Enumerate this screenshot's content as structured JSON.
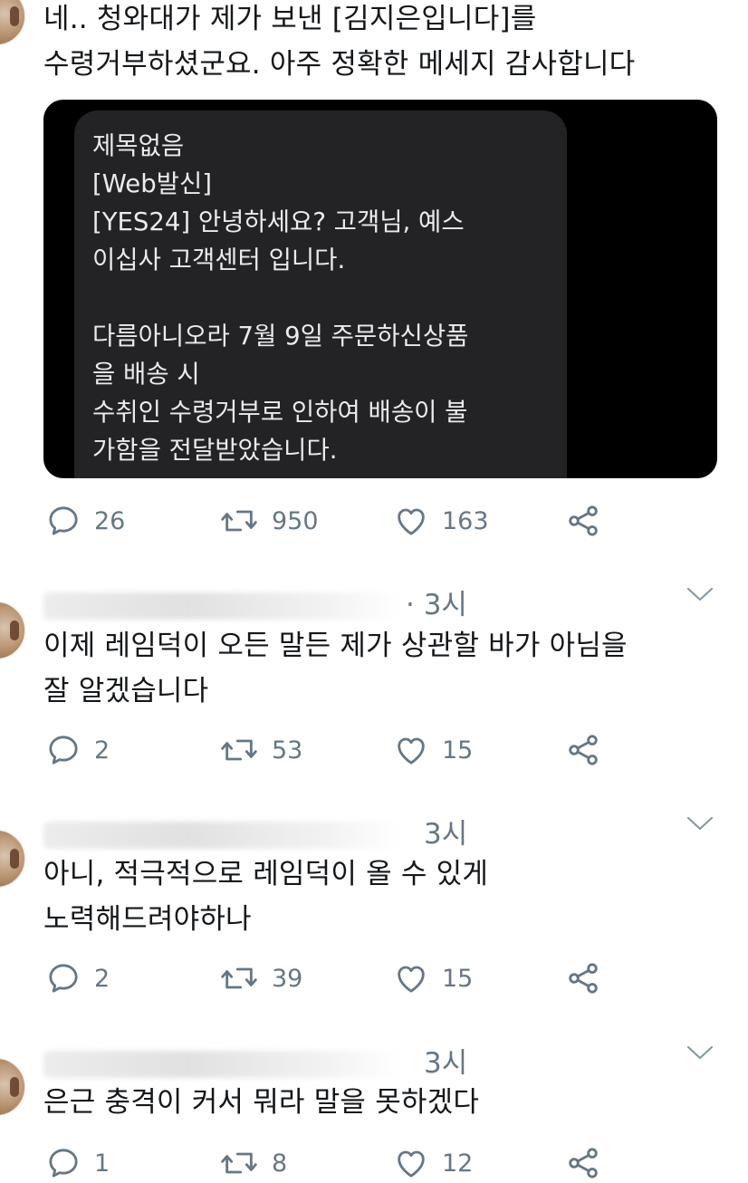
{
  "tweets": [
    {
      "timestamp": "",
      "lines": [
        "네.. 청와대가 제가 보낸 [김지은입니다]를",
        "수령거부하셨군요. 아주 정확한 메세지 감사합니다"
      ],
      "reply_count": "26",
      "retweet_count": "950",
      "like_count": "163"
    },
    {
      "timestamp": "· 3시",
      "lines": [
        "이제 레임덕이 오든 말든 제가 상관할 바가 아님을",
        "잘 알겠습니다"
      ],
      "reply_count": "2",
      "retweet_count": "53",
      "like_count": "15"
    },
    {
      "timestamp": "3시",
      "lines": [
        "아니, 적극적으로 레임덕이 올 수 있게",
        "노력해드려야하나"
      ],
      "reply_count": "2",
      "retweet_count": "39",
      "like_count": "15"
    },
    {
      "timestamp": "3시",
      "lines": [
        "은근 충격이 커서 뭐라 말을 못하겠다"
      ],
      "reply_count": "1",
      "retweet_count": "8",
      "like_count": "12"
    }
  ],
  "sms": {
    "lines": [
      "제목없음",
      "[Web발신]",
      "[YES24] 안녕하세요?  고객님, 예스",
      "이십사 고객센터 입니다.",
      "",
      "다름아니오라 7월 9일 주문하신상품",
      "을 배송 시",
      "수취인 수령거부로 인하여 배송이 불",
      "가함을 전달받았습니다."
    ]
  },
  "colors": {
    "text": "#14171a",
    "secondary": "#657786",
    "icon": "#657786",
    "media_bg": "#000000",
    "bubble_bg": "#232325"
  },
  "icons": [
    "reply-icon",
    "retweet-icon",
    "like-icon",
    "share-icon",
    "chevron-down-icon"
  ]
}
